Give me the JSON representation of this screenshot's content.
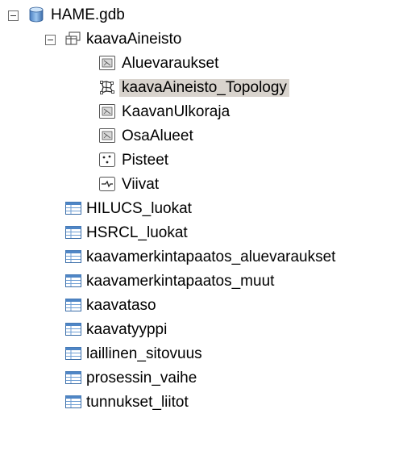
{
  "tree": {
    "database": {
      "label": "HAME.gdb",
      "icon": "geodatabase-icon",
      "expanded": true
    },
    "dataset": {
      "label": "kaavaAineisto",
      "icon": "feature-dataset-icon",
      "expanded": true
    },
    "dataset_items": [
      {
        "label": "Aluevaraukset",
        "icon": "polygon-feature-class-icon"
      },
      {
        "label": "kaavaAineisto_Topology",
        "icon": "topology-icon",
        "selected": true
      },
      {
        "label": "KaavanUlkoraja",
        "icon": "polygon-feature-class-icon"
      },
      {
        "label": "OsaAlueet",
        "icon": "polygon-feature-class-icon"
      },
      {
        "label": "Pisteet",
        "icon": "point-feature-class-icon"
      },
      {
        "label": "Viivat",
        "icon": "line-feature-class-icon"
      }
    ],
    "tables": [
      {
        "label": "HILUCS_luokat",
        "icon": "table-icon"
      },
      {
        "label": "HSRCL_luokat",
        "icon": "table-icon"
      },
      {
        "label": "kaavamerkintapaatos_aluevaraukset",
        "icon": "table-icon"
      },
      {
        "label": "kaavamerkintapaatos_muut",
        "icon": "table-icon"
      },
      {
        "label": "kaavataso",
        "icon": "table-icon"
      },
      {
        "label": "kaavatyyppi",
        "icon": "table-icon"
      },
      {
        "label": "laillinen_sitovuus",
        "icon": "table-icon"
      },
      {
        "label": "prosessin_vaihe",
        "icon": "table-icon"
      },
      {
        "label": "tunnukset_liitot",
        "icon": "table-icon"
      }
    ]
  }
}
